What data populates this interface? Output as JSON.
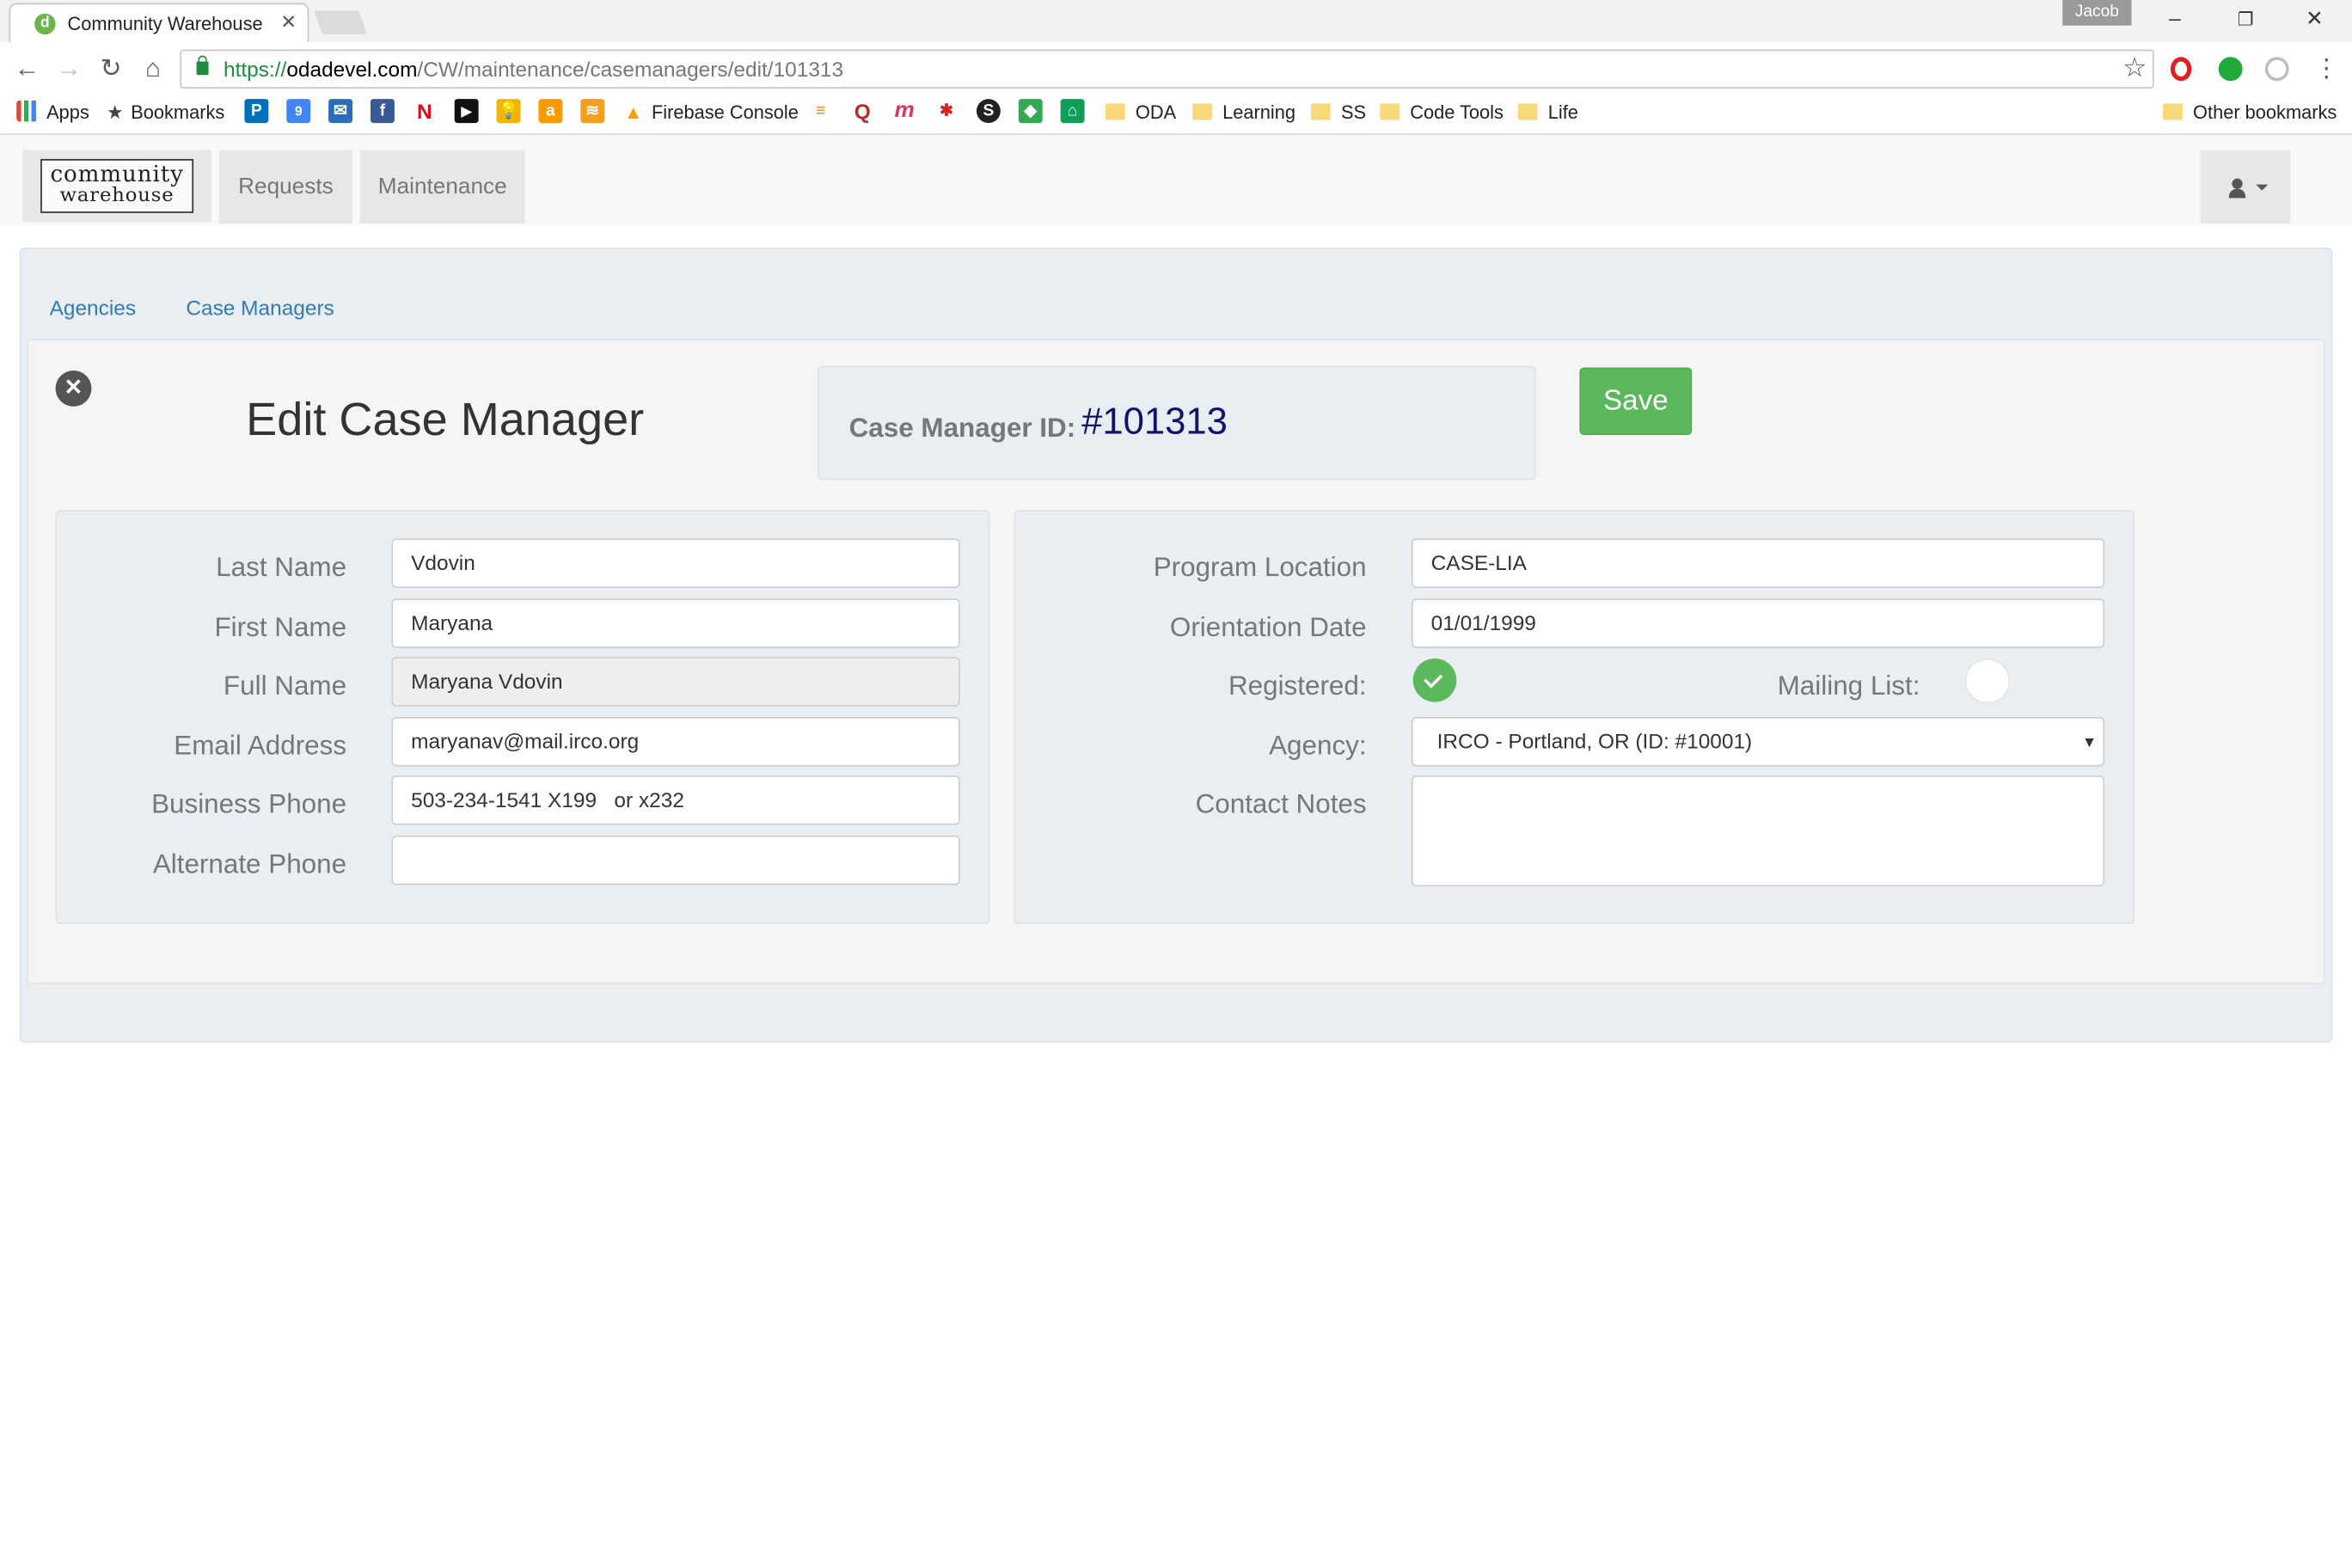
{
  "browser": {
    "tab_title": "Community Warehouse",
    "tab_favicon": "d",
    "profile_name": "Jacob",
    "url_scheme": "https://",
    "url_host": "odadevel.com",
    "url_path": "/CW/maintenance/casemanagers/edit/101313",
    "bookmarks": {
      "apps": "Apps",
      "bookmarks": "Bookmarks",
      "firebase": "Firebase Console",
      "oda": "ODA",
      "learning": "Learning",
      "ss": "SS",
      "code_tools": "Code Tools",
      "life": "Life",
      "other": "Other bookmarks"
    }
  },
  "app": {
    "logo_line1": "community",
    "logo_line2": "warehouse",
    "nav": {
      "requests": "Requests",
      "maintenance": "Maintenance"
    },
    "subtabs": {
      "agencies": "Agencies",
      "case_managers": "Case Managers"
    },
    "page_title": "Edit Case Manager",
    "case_manager_id_label": "Case Manager ID:",
    "case_manager_id_value": "#101313",
    "save_label": "Save"
  },
  "form": {
    "last_name": {
      "label": "Last Name",
      "value": "Vdovin"
    },
    "first_name": {
      "label": "First Name",
      "value": "Maryana"
    },
    "full_name": {
      "label": "Full Name",
      "value": "Maryana Vdovin"
    },
    "email": {
      "label": "Email Address",
      "value": "maryanav@mail.irco.org"
    },
    "business_phone": {
      "label": "Business Phone",
      "value": "503-234-1541 X199   or x232"
    },
    "alternate_phone": {
      "label": "Alternate Phone",
      "value": ""
    },
    "program_location": {
      "label": "Program Location",
      "value": "CASE-LIA"
    },
    "orientation_date": {
      "label": "Orientation Date",
      "value": "01/01/1999"
    },
    "registered": {
      "label": "Registered:",
      "checked": true
    },
    "mailing_list": {
      "label": "Mailing List:",
      "checked": false
    },
    "agency": {
      "label": "Agency:",
      "value": "IRCO - Portland, OR (ID: #10001)"
    },
    "contact_notes": {
      "label": "Contact Notes",
      "value": ""
    }
  },
  "colors": {
    "accent_link": "#337ab7",
    "save_green": "#5cb85c",
    "id_value": "#12126e",
    "panel_bg": "#e8eef1"
  }
}
